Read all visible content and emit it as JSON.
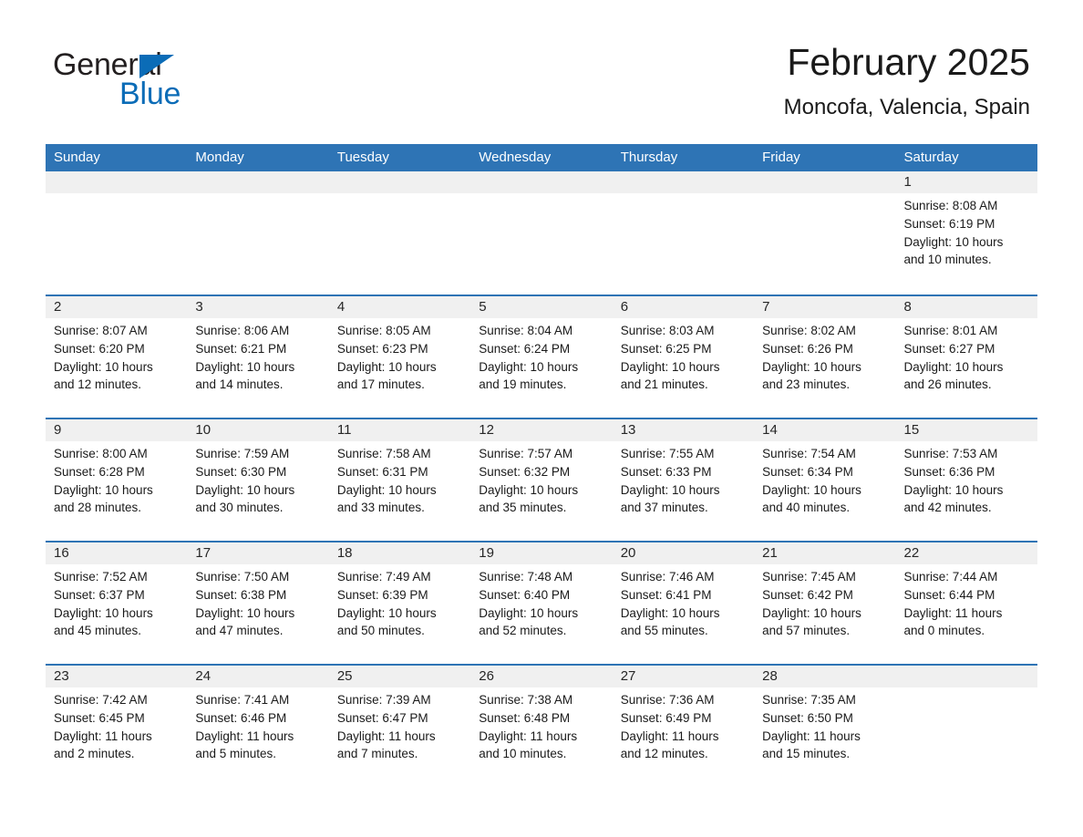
{
  "brand": {
    "name_part1": "General",
    "name_part2": "Blue",
    "accent_color": "#0b6cb7"
  },
  "header": {
    "title": "February 2025",
    "subtitle": "Moncofa, Valencia, Spain"
  },
  "theme": {
    "header_bar_color": "#2e74b5",
    "day_band_color": "#f0f0f0",
    "text_color": "#1a1a1a",
    "background": "#ffffff"
  },
  "weekdays": [
    "Sunday",
    "Monday",
    "Tuesday",
    "Wednesday",
    "Thursday",
    "Friday",
    "Saturday"
  ],
  "weeks": [
    [
      {
        "day": "",
        "lines": []
      },
      {
        "day": "",
        "lines": []
      },
      {
        "day": "",
        "lines": []
      },
      {
        "day": "",
        "lines": []
      },
      {
        "day": "",
        "lines": []
      },
      {
        "day": "",
        "lines": []
      },
      {
        "day": "1",
        "lines": [
          "Sunrise: 8:08 AM",
          "Sunset: 6:19 PM",
          "Daylight: 10 hours",
          "and 10 minutes."
        ]
      }
    ],
    [
      {
        "day": "2",
        "lines": [
          "Sunrise: 8:07 AM",
          "Sunset: 6:20 PM",
          "Daylight: 10 hours",
          "and 12 minutes."
        ]
      },
      {
        "day": "3",
        "lines": [
          "Sunrise: 8:06 AM",
          "Sunset: 6:21 PM",
          "Daylight: 10 hours",
          "and 14 minutes."
        ]
      },
      {
        "day": "4",
        "lines": [
          "Sunrise: 8:05 AM",
          "Sunset: 6:23 PM",
          "Daylight: 10 hours",
          "and 17 minutes."
        ]
      },
      {
        "day": "5",
        "lines": [
          "Sunrise: 8:04 AM",
          "Sunset: 6:24 PM",
          "Daylight: 10 hours",
          "and 19 minutes."
        ]
      },
      {
        "day": "6",
        "lines": [
          "Sunrise: 8:03 AM",
          "Sunset: 6:25 PM",
          "Daylight: 10 hours",
          "and 21 minutes."
        ]
      },
      {
        "day": "7",
        "lines": [
          "Sunrise: 8:02 AM",
          "Sunset: 6:26 PM",
          "Daylight: 10 hours",
          "and 23 minutes."
        ]
      },
      {
        "day": "8",
        "lines": [
          "Sunrise: 8:01 AM",
          "Sunset: 6:27 PM",
          "Daylight: 10 hours",
          "and 26 minutes."
        ]
      }
    ],
    [
      {
        "day": "9",
        "lines": [
          "Sunrise: 8:00 AM",
          "Sunset: 6:28 PM",
          "Daylight: 10 hours",
          "and 28 minutes."
        ]
      },
      {
        "day": "10",
        "lines": [
          "Sunrise: 7:59 AM",
          "Sunset: 6:30 PM",
          "Daylight: 10 hours",
          "and 30 minutes."
        ]
      },
      {
        "day": "11",
        "lines": [
          "Sunrise: 7:58 AM",
          "Sunset: 6:31 PM",
          "Daylight: 10 hours",
          "and 33 minutes."
        ]
      },
      {
        "day": "12",
        "lines": [
          "Sunrise: 7:57 AM",
          "Sunset: 6:32 PM",
          "Daylight: 10 hours",
          "and 35 minutes."
        ]
      },
      {
        "day": "13",
        "lines": [
          "Sunrise: 7:55 AM",
          "Sunset: 6:33 PM",
          "Daylight: 10 hours",
          "and 37 minutes."
        ]
      },
      {
        "day": "14",
        "lines": [
          "Sunrise: 7:54 AM",
          "Sunset: 6:34 PM",
          "Daylight: 10 hours",
          "and 40 minutes."
        ]
      },
      {
        "day": "15",
        "lines": [
          "Sunrise: 7:53 AM",
          "Sunset: 6:36 PM",
          "Daylight: 10 hours",
          "and 42 minutes."
        ]
      }
    ],
    [
      {
        "day": "16",
        "lines": [
          "Sunrise: 7:52 AM",
          "Sunset: 6:37 PM",
          "Daylight: 10 hours",
          "and 45 minutes."
        ]
      },
      {
        "day": "17",
        "lines": [
          "Sunrise: 7:50 AM",
          "Sunset: 6:38 PM",
          "Daylight: 10 hours",
          "and 47 minutes."
        ]
      },
      {
        "day": "18",
        "lines": [
          "Sunrise: 7:49 AM",
          "Sunset: 6:39 PM",
          "Daylight: 10 hours",
          "and 50 minutes."
        ]
      },
      {
        "day": "19",
        "lines": [
          "Sunrise: 7:48 AM",
          "Sunset: 6:40 PM",
          "Daylight: 10 hours",
          "and 52 minutes."
        ]
      },
      {
        "day": "20",
        "lines": [
          "Sunrise: 7:46 AM",
          "Sunset: 6:41 PM",
          "Daylight: 10 hours",
          "and 55 minutes."
        ]
      },
      {
        "day": "21",
        "lines": [
          "Sunrise: 7:45 AM",
          "Sunset: 6:42 PM",
          "Daylight: 10 hours",
          "and 57 minutes."
        ]
      },
      {
        "day": "22",
        "lines": [
          "Sunrise: 7:44 AM",
          "Sunset: 6:44 PM",
          "Daylight: 11 hours",
          "and 0 minutes."
        ]
      }
    ],
    [
      {
        "day": "23",
        "lines": [
          "Sunrise: 7:42 AM",
          "Sunset: 6:45 PM",
          "Daylight: 11 hours",
          "and 2 minutes."
        ]
      },
      {
        "day": "24",
        "lines": [
          "Sunrise: 7:41 AM",
          "Sunset: 6:46 PM",
          "Daylight: 11 hours",
          "and 5 minutes."
        ]
      },
      {
        "day": "25",
        "lines": [
          "Sunrise: 7:39 AM",
          "Sunset: 6:47 PM",
          "Daylight: 11 hours",
          "and 7 minutes."
        ]
      },
      {
        "day": "26",
        "lines": [
          "Sunrise: 7:38 AM",
          "Sunset: 6:48 PM",
          "Daylight: 11 hours",
          "and 10 minutes."
        ]
      },
      {
        "day": "27",
        "lines": [
          "Sunrise: 7:36 AM",
          "Sunset: 6:49 PM",
          "Daylight: 11 hours",
          "and 12 minutes."
        ]
      },
      {
        "day": "28",
        "lines": [
          "Sunrise: 7:35 AM",
          "Sunset: 6:50 PM",
          "Daylight: 11 hours",
          "and 15 minutes."
        ]
      },
      {
        "day": "",
        "lines": []
      }
    ]
  ]
}
